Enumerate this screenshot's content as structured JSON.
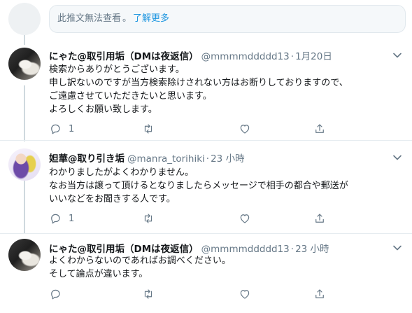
{
  "notice": {
    "text": "此推文無法查看",
    "separator": "。",
    "link": "了解更多"
  },
  "tweets": [
    {
      "name": "にゃた@取引用垢（DMは夜返信）",
      "handle": "@mmmmddddd13",
      "dot": "·",
      "time": "1月20日",
      "lines": [
        "検索からありがとうございます。",
        "申し訳ないのですが当方検索除けされない方はお断りしておりますので、",
        "ご遠慮させていただきたいと思います。",
        "よろしくお願い致します。"
      ],
      "reply_count": "1",
      "avatar": "cat-photo"
    },
    {
      "name": "妲華@取り引き垢",
      "handle": "@manra_torihiki",
      "dot": "·",
      "time": "23 小時",
      "lines": [
        "わかりましたがよくわかりません。",
        "なお当方は譲って頂けるとなりましたらメッセージで相手の都合や郵送が",
        "いいなどをお聞きする人です。"
      ],
      "reply_count": "1",
      "avatar": "anime-character"
    },
    {
      "name": "にゃた@取引用垢（DMは夜返信）",
      "handle": "@mmmmddddd13",
      "dot": "·",
      "time": "23 小時",
      "lines": [
        "よくわからないのであればお調べください。",
        "そして論点が違います。"
      ],
      "reply_count": "",
      "avatar": "cat-photo"
    }
  ],
  "icons": {
    "reply": "reply-icon",
    "retweet": "retweet-icon",
    "like": "heart-icon",
    "share": "share-icon",
    "menu": "chevron-down-icon"
  },
  "colors": {
    "link": "#1b95e0",
    "secondary_text": "#657786",
    "primary_text": "#14171a",
    "thread_line": "#cfd9de"
  }
}
